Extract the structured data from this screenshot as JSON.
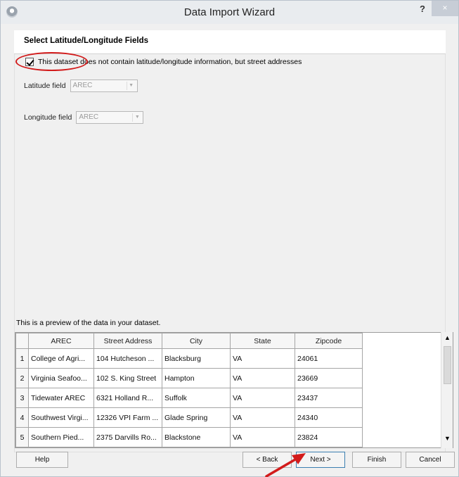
{
  "window": {
    "title": "Data Import Wizard",
    "help_label": "?",
    "close_label": "×"
  },
  "header": {
    "title": "Select Latitude/Longitude Fields"
  },
  "options": {
    "address_checkbox_label": "This dataset does not contain latitude/longitude information, but street addresses",
    "address_checkbox_checked": true
  },
  "fields": {
    "latitude_label": "Latitude field",
    "latitude_value": "AREC",
    "longitude_label": "Longitude field",
    "longitude_value": "AREC"
  },
  "preview": {
    "label": "This is a preview of the data in your dataset.",
    "columns": [
      "AREC",
      "Street Address",
      "City",
      "State",
      "Zipcode"
    ],
    "rows": [
      {
        "num": "1",
        "arec": "College of Agri...",
        "street": "104 Hutcheson ...",
        "city": "Blacksburg",
        "state": "VA",
        "zip": "24061"
      },
      {
        "num": "2",
        "arec": "Virginia Seafoo...",
        "street": "102 S. King Street",
        "city": "Hampton",
        "state": "VA",
        "zip": "23669"
      },
      {
        "num": "3",
        "arec": "Tidewater AREC",
        "street": "6321 Holland R...",
        "city": "Suffolk",
        "state": "VA",
        "zip": "23437"
      },
      {
        "num": "4",
        "arec": "Southwest Virgi...",
        "street": "12326 VPI Farm ...",
        "city": "Glade Spring",
        "state": "VA",
        "zip": "24340"
      },
      {
        "num": "5",
        "arec": "Southern Pied...",
        "street": "2375 Darvills Ro...",
        "city": "Blackstone",
        "state": "VA",
        "zip": "23824"
      }
    ]
  },
  "buttons": {
    "help": "Help",
    "back": "< Back",
    "next": "Next >",
    "finish": "Finish",
    "cancel": "Cancel"
  },
  "colors": {
    "annotation_red": "#d21b1b",
    "window_bg": "#f0f0f0",
    "default_button_border": "#3c7fb1"
  }
}
